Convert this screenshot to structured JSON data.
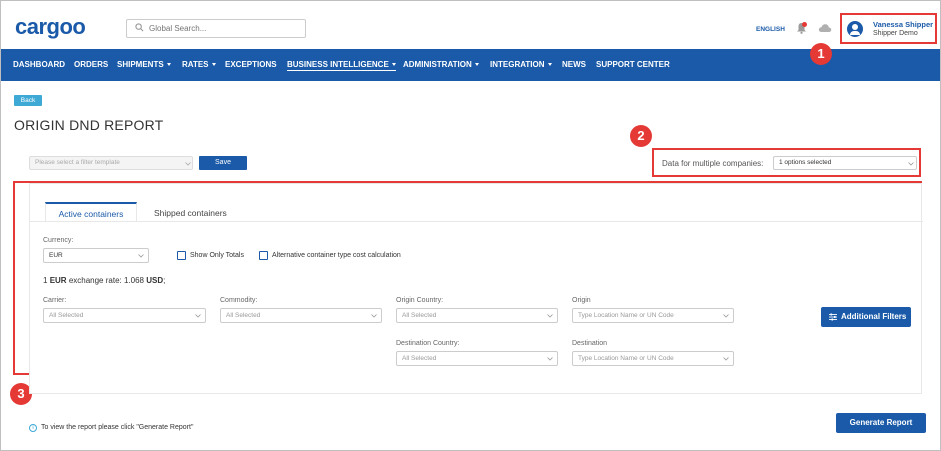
{
  "header": {
    "logo": "cargoo",
    "search_placeholder": "Global Search...",
    "language": "ENGLISH",
    "user_name": "Vanessa Shipper",
    "user_company": "Shipper Demo"
  },
  "nav": {
    "items": [
      {
        "label": "DASHBOARD"
      },
      {
        "label": "ORDERS"
      },
      {
        "label": "SHIPMENTS"
      },
      {
        "label": "RATES"
      },
      {
        "label": "EXCEPTIONS"
      },
      {
        "label": "BUSINESS INTELLIGENCE"
      },
      {
        "label": "ADMINISTRATION"
      },
      {
        "label": "INTEGRATION"
      },
      {
        "label": "NEWS"
      },
      {
        "label": "SUPPORT CENTER"
      }
    ],
    "active": "BUSINESS INTELLIGENCE"
  },
  "badges": [
    "1",
    "2",
    "3"
  ],
  "page": {
    "back_label": "Back",
    "title": "ORIGIN DND REPORT",
    "filter_template_placeholder": "Please select a filter template",
    "save_label": "Save",
    "multi_company_label": "Data for multiple companies:",
    "multi_company_value": "1 options selected"
  },
  "tabs": {
    "active": "Active containers",
    "inactive": "Shipped containers"
  },
  "filters": {
    "currency_label": "Currency:",
    "currency_value": "EUR",
    "show_only_totals": "Show Only Totals",
    "alt_calc": "Alternative container type cost calculation",
    "rate_prefix": "1",
    "rate_currency": "EUR",
    "rate_mid": "exchange rate: 1.068",
    "rate_target": "USD",
    "rate_suffix": ";",
    "carrier_label": "Carrier:",
    "carrier_value": "All Selected",
    "commodity_label": "Commodity:",
    "commodity_value": "All Selected",
    "origin_country_label": "Origin Country:",
    "origin_country_value": "All Selected",
    "origin_label": "Origin",
    "origin_placeholder": "Type Location Name or UN Code",
    "dest_country_label": "Destination Country:",
    "dest_country_value": "All Selected",
    "dest_label": "Destination",
    "dest_placeholder": "Type Location Name or UN Code",
    "additional_filters": "Additional Filters"
  },
  "footer": {
    "hint": "To view the report please click \"Generate Report\"",
    "generate_label": "Generate Report"
  },
  "colors": {
    "brand": "#1a5aa8",
    "annotation": "#e53935",
    "back": "#3fa9d6"
  }
}
